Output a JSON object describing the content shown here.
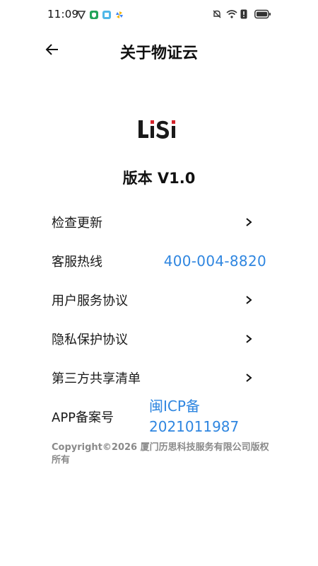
{
  "status_bar": {
    "time": "11:09",
    "battery_icon": "battery-icon",
    "wifi_icon": "wifi-icon"
  },
  "header": {
    "title": "关于物证云",
    "back_icon": "back-arrow-icon"
  },
  "logo": {
    "text": "LiSi"
  },
  "version": "版本 V1.0",
  "menu": {
    "check_update": "检查更新",
    "hotline_label": "客服热线",
    "hotline_value": "400-004-8820",
    "user_agreement": "用户服务协议",
    "privacy_policy": "隐私保护协议",
    "third_party_list": "第三方共享清单",
    "icp_label": "APP备案号",
    "icp_line1": "闽ICP备",
    "icp_line2": "2021011987"
  },
  "copyright": "Copyright©2026 厦门历思科技服务有限公司版权所有",
  "colors": {
    "link": "#2f86e0",
    "logo_dark": "#1a1a1a",
    "logo_red": "#d4232b"
  }
}
